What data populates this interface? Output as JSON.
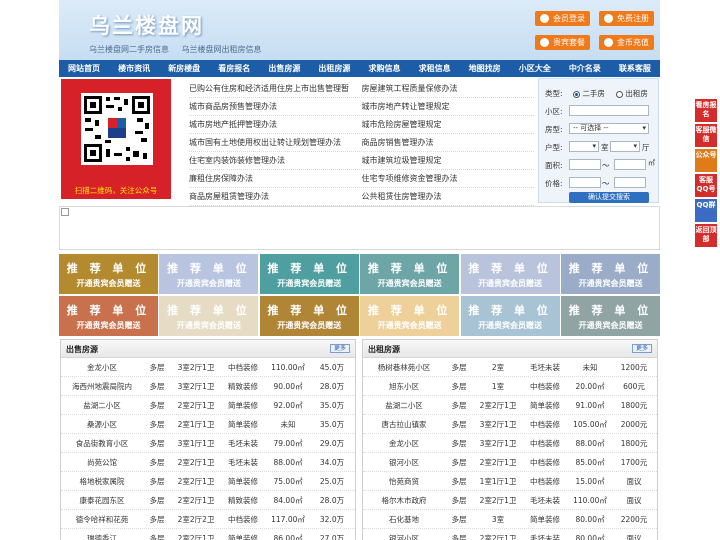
{
  "header": {
    "logo": "乌兰楼盘网",
    "subtitle_1": "乌兰楼盘网二手房信息",
    "subtitle_2": "乌兰楼盘网出租房信息",
    "buttons": [
      "会员登录",
      "免费注册",
      "贵宾套餐",
      "金币充值"
    ]
  },
  "nav": [
    "网站首页",
    "楼市资讯",
    "新房楼盘",
    "看房报名",
    "出售房源",
    "出租房源",
    "求购信息",
    "求租信息",
    "地图找房",
    "小区大全",
    "中介名录",
    "联系客服"
  ],
  "qr_caption": "扫描二维码，关注公众号",
  "news": [
    [
      "已购公有住房和经济适用住房上市出售管理暂",
      "房屋建筑工程质量保修办法"
    ],
    [
      "城市商品房预售管理办法",
      "城市房地产转让管理规定"
    ],
    [
      "城市房地产抵押管理办法",
      "城市危险房屋管理规定"
    ],
    [
      "城市国有土地使用权出让转让规划管理办法",
      "商品房销售管理办法"
    ],
    [
      "住宅室内装饰装修管理办法",
      "城市建筑垃圾管理规定"
    ],
    [
      "廉租住房保障办法",
      "住宅专项维修资金管理办法"
    ],
    [
      "商品房屋租赁管理办法",
      "公共租赁住房管理办法"
    ]
  ],
  "search": {
    "type_label": "类型:",
    "opt1": "二手房",
    "opt2": "出租房",
    "community_label": "小区:",
    "housetype_label": "房型:",
    "select_placeholder": "-- 可选择 --",
    "layout_label": "户型:",
    "unit_room": "室",
    "unit_hall": "厅",
    "area_label": "面积:",
    "price_label": "价格:",
    "tilde": "～",
    "submit": "确认提交搜索"
  },
  "ads": {
    "title": "推 荐 单 位",
    "sub": "开通贵宾会员赠送",
    "colors": [
      "#b48a2f",
      "#b8c4e0",
      "#4f9fa0",
      "#6ea6a8",
      "#b9c4dc",
      "#9aacc8",
      "#c9704d",
      "#e6dcc5",
      "#b08536",
      "#eed19a",
      "#a8c4d4",
      "#90a4a4"
    ]
  },
  "sale": {
    "title": "出售房源",
    "more": "更多",
    "rows": [
      [
        "金龙小区",
        "多层",
        "3室2厅1卫",
        "中档装修",
        "110.00㎡",
        "45.0万"
      ],
      [
        "海西州地震局院内",
        "多层",
        "3室2厅1卫",
        "精致装修",
        "90.00㎡",
        "28.0万"
      ],
      [
        "盐湖二小区",
        "多层",
        "2室2厅1卫",
        "简单装修",
        "92.00㎡",
        "35.0万"
      ],
      [
        "桑源小区",
        "多层",
        "2室1厅1卫",
        "简单装修",
        "未知",
        "35.0万"
      ],
      [
        "食品街教育小区",
        "多层",
        "3室1厅1卫",
        "毛坯未装",
        "79.00㎡",
        "29.0万"
      ],
      [
        "尚苑公馆",
        "多层",
        "2室2厅1卫",
        "毛坯未装",
        "88.00㎡",
        "34.0万"
      ],
      [
        "格地税家属院",
        "多层",
        "2室2厅1卫",
        "简单装修",
        "75.00㎡",
        "25.0万"
      ],
      [
        "康泰花园东区",
        "多层",
        "2室2厅1卫",
        "精致装修",
        "84.00㎡",
        "28.0万"
      ],
      [
        "德令哈祥和花苑",
        "多层",
        "2室2厅2卫",
        "中档装修",
        "117.00㎡",
        "32.0万"
      ],
      [
        "瑞德香江",
        "多层",
        "2室2厅1卫",
        "简单装修",
        "86.00㎡",
        "27.0万"
      ]
    ]
  },
  "rent": {
    "title": "出租房源",
    "more": "更多",
    "rows": [
      [
        "杨树巷林苑小区",
        "多层",
        "2室",
        "毛坯未装",
        "未知",
        "1200元"
      ],
      [
        "旭东小区",
        "多层",
        "1室",
        "中档装修",
        "20.00㎡",
        "600元"
      ],
      [
        "盐湖二小区",
        "多层",
        "2室2厅1卫",
        "简单装修",
        "91.00㎡",
        "1800元"
      ],
      [
        "唐古拉山镇家",
        "多层",
        "3室2厅1卫",
        "中档装修",
        "105.00㎡",
        "2000元"
      ],
      [
        "金龙小区",
        "多层",
        "3室2厅1卫",
        "中档装修",
        "88.00㎡",
        "1800元"
      ],
      [
        "银河小区",
        "多层",
        "2室2厅1卫",
        "中档装修",
        "85.00㎡",
        "1700元"
      ],
      [
        "怡苑商贸",
        "多层",
        "1室1厅1卫",
        "中档装修",
        "15.00㎡",
        "面议"
      ],
      [
        "格尔木市政府",
        "多层",
        "2室2厅1卫",
        "毛坯未装",
        "110.00㎡",
        "面议"
      ],
      [
        "石化基地",
        "多层",
        "3室",
        "简单装修",
        "80.00㎡",
        "2200元"
      ],
      [
        "银河小区",
        "多层",
        "2室2厅1卫",
        "毛坯未装",
        "80.00㎡",
        "面议"
      ]
    ]
  },
  "side": [
    "看房报名",
    "客服微信",
    "公众号",
    "客服QQ号",
    "QQ群",
    "返回顶部"
  ],
  "side_colors": [
    "#d42b2b",
    "#d42b2b",
    "#e07b1a",
    "#d42b2b",
    "#3b6bc2",
    "#d42b2b"
  ]
}
